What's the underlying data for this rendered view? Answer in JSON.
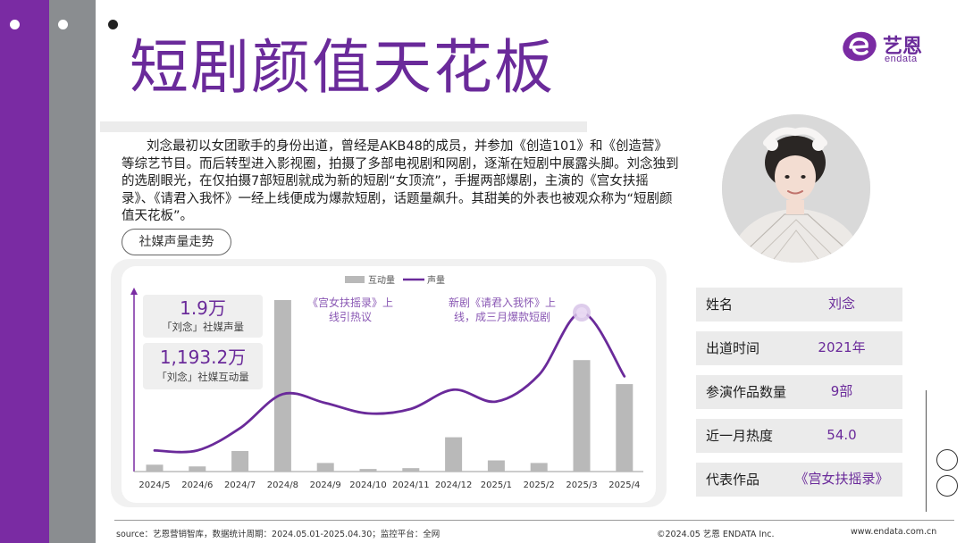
{
  "page": {
    "title": "短剧颜值天花板",
    "bio": "刘念最初以女团歌手的身份出道，曾经是AKB48的成员，并参加《创造101》和《创造营》等综艺节目。而后转型进入影视圈，拍摄了多部电视剧和网剧，逐渐在短剧中展露头脚。刘念独到的选剧眼光，在仅拍摄7部短剧就成为新的短剧“女顶流”，手握两部爆剧，主演的《宫女扶摇录》、《请君入我怀》一经上线便成为爆款短剧，话题量飙升。其甜美的外表也被观众称为“短剧颜值天花板”。",
    "section_label": "社媒声量走势"
  },
  "logo": {
    "cn": "艺恩",
    "en": "endata"
  },
  "stats": {
    "volume_value": "1.9万",
    "volume_label": "「刘念」社媒声量",
    "interaction_value": "1,193.2万",
    "interaction_label": "「刘念」社媒互动量"
  },
  "annotations": {
    "a1_line1": "《宫女扶摇录》上",
    "a1_line2": "线引热议",
    "a2_line1": "新剧《请君入我怀》上",
    "a2_line2": "线，成三月爆款短剧"
  },
  "chart_data": {
    "type": "bar",
    "categories": [
      "2024/5",
      "2024/6",
      "2024/7",
      "2024/8",
      "2024/9",
      "2024/10",
      "2024/11",
      "2024/12",
      "2025/1",
      "2025/2",
      "2025/3",
      "2025/4"
    ],
    "legend": [
      "互动量",
      "声量"
    ],
    "legend_placement": "top",
    "series": [
      {
        "name": "互动量",
        "type": "bar",
        "color": "#b9b9b9",
        "values": [
          4,
          3,
          12,
          100,
          5,
          1.5,
          2,
          20,
          6.5,
          5,
          65,
          51
        ]
      },
      {
        "name": "声量",
        "type": "line",
        "color": "#6a2a9a",
        "values": [
          7,
          7,
          22,
          45,
          39,
          32,
          35,
          48,
          40,
          58,
          100,
          57
        ]
      }
    ],
    "grid": false,
    "ylim": [
      0,
      100
    ],
    "highlight_index": 10
  },
  "profile": {
    "rows": [
      {
        "label": "姓名",
        "value": "刘念"
      },
      {
        "label": "出道时间",
        "value": "2021年"
      },
      {
        "label": "参演作品数量",
        "value": "9部"
      },
      {
        "label": "近一月热度",
        "value": "54.0"
      },
      {
        "label": "代表作品",
        "value": "《宫女扶摇录》"
      }
    ]
  },
  "footer": {
    "source": "source：艺恩营销智库，数据统计周期：2024.05.01-2025.04.30；监控平台：全网",
    "copyright": "©2024.05  艺恩 ENDATA Inc.",
    "url": "www.endata.com.cn"
  },
  "colors": {
    "accent": "#6a2a9a",
    "strip_purple": "#7a2ba3",
    "strip_gray": "#8a8d90"
  }
}
